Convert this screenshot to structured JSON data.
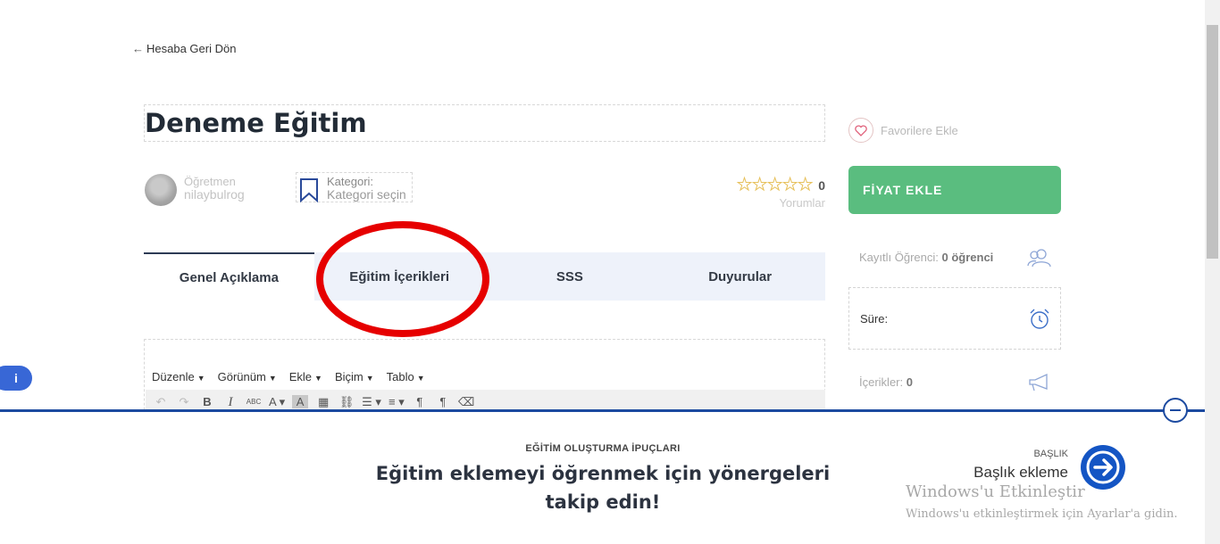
{
  "back_link": "Hesaba Geri Dön",
  "course": {
    "title": "Deneme Eğitim",
    "teacher_label": "Öğretmen",
    "teacher_name": "nilaybulrog",
    "category_label": "Kategori:",
    "category_value": "Kategori seçin",
    "rating_count": "0",
    "rating_label": "Yorumlar"
  },
  "tabs": [
    {
      "label": "Genel Açıklama"
    },
    {
      "label": "Eğitim İçerikleri"
    },
    {
      "label": "SSS"
    },
    {
      "label": "Duyurular"
    }
  ],
  "editor": {
    "menu": [
      "Düzenle",
      "Görünüm",
      "Ekle",
      "Biçim",
      "Tablo"
    ],
    "toolbar_icons": [
      "undo-icon",
      "redo-icon",
      "bold-icon",
      "italic-icon",
      "strikethrough-icon",
      "font-color-icon",
      "background-color-icon",
      "table-icon",
      "link-icon",
      "bullet-list-icon",
      "numbered-list-icon",
      "ltr-icon",
      "rtl-icon",
      "clear-format-icon"
    ]
  },
  "sidebar": {
    "favorite_label": "Favorilere Ekle",
    "price_button": "FİYAT EKLE",
    "enrolled_label": "Kayıtlı Öğrenci:",
    "enrolled_value": "0 öğrenci",
    "duration_label": "Süre:",
    "contents_label": "İçerikler:",
    "contents_value": "0"
  },
  "tips": {
    "kicker": "EĞİTİM OLUŞTURMA İPUÇLARI",
    "title_line1": "Eğitim eklemeyi öğrenmek için yönergeleri",
    "title_line2": "takip edin!",
    "next_label": "BAŞLIK",
    "next_title": "Başlık ekleme"
  },
  "watermark": {
    "line1": "Windows'u Etkinleştir",
    "line2": "Windows'u etkinleştirmek için Ayarlar'a gidin."
  },
  "colors": {
    "accent_green": "#5abd7f",
    "accent_blue": "#1c4aa0",
    "highlight_red": "#e60000"
  }
}
